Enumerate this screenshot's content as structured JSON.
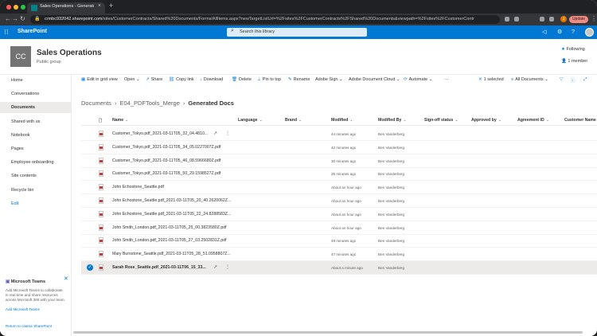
{
  "browser": {
    "tab_title": "Sales Operations - Generated",
    "url_domain": "crmbc932042.sharepoint.com",
    "url_path": "/sites/CustomerContracts/Shared%20Documents/Forms/AllItems.aspx?newTargetListUrl=%2Fsites%2FCustomerContracts%2FShared%20Documents&viewpath=%2Fsites%2FCustomerContr",
    "profile_initial": "J",
    "update_label": "Update"
  },
  "suite": {
    "brand": "SharePoint",
    "search_placeholder": "Search this library"
  },
  "site": {
    "logo_text": "CC",
    "title": "Sales Operations",
    "subtitle": "Public group",
    "following": "Following",
    "members": "1 member"
  },
  "nav": {
    "items": [
      "Home",
      "Conversations",
      "Documents",
      "Shared with us",
      "Notebook",
      "Pages",
      "Employee onboarding",
      "Site contents",
      "Recycle bin"
    ],
    "edit": "Edit",
    "return_classic": "Return to classic SharePoint"
  },
  "teams_card": {
    "title": "Microsoft Teams",
    "body": "Add Microsoft Teams to collaborate in real time and share resources across Microsoft 365 with your team.",
    "link": "Add Microsoft Teams"
  },
  "commands": {
    "edit_grid": "Edit in grid view",
    "open": "Open",
    "share": "Share",
    "copy_link": "Copy link",
    "download": "Download",
    "delete": "Delete",
    "pin": "Pin to top",
    "rename": "Rename",
    "adobe_sign": "Adobe Sign",
    "adobe_cloud": "Adobe Document Cloud",
    "automate": "Automate",
    "selected": "1 selected",
    "view": "All Documents"
  },
  "breadcrumb": [
    "Documents",
    "E04_PDFTools_Merge",
    "Generated Docs"
  ],
  "columns": [
    "Name",
    "Language",
    "Brand",
    "Modified",
    "Modified By",
    "Sign-off status",
    "Approved by",
    "Agreement ID",
    "Customer Name"
  ],
  "rows": [
    {
      "name": "Customer_Tokyo.pdf_2021-03-11T05_32_04.4810...",
      "modified": "44 minutes ago",
      "by": "Ben Vanderberg",
      "share": true
    },
    {
      "name": "Customer_Tokyo.pdf_2021-03-11T05_34_05.0227007Z.pdf",
      "modified": "42 minutes ago",
      "by": "Ben Vanderberg",
      "share": false
    },
    {
      "name": "Customer_Tokyo.pdf_2021-03-11T05_46_08.5966680Z.pdf",
      "modified": "30 minutes ago",
      "by": "Ben Vanderberg",
      "share": false
    },
    {
      "name": "Customer_Tokyo.pdf_2021-03-11T05_50_29.1598527Z.pdf",
      "modified": "26 minutes ago",
      "by": "Ben Vanderberg",
      "share": false
    },
    {
      "name": "John Echostone_Seattle.pdf",
      "modified": "About an hour ago",
      "by": "Ben Vanderberg",
      "share": false
    },
    {
      "name": "John Echostone_Seattle.pdf_2021-03-11T05_20_40.2620062Z...",
      "modified": "About an hour ago",
      "by": "Ben Vanderberg",
      "share": false
    },
    {
      "name": "John Echostone_Seattle.pdf_2021-03-11T05_22_24.8288583Z...",
      "modified": "About an hour ago",
      "by": "Ben Vanderberg",
      "share": false
    },
    {
      "name": "John Smith_London.pdf_2021-03-11T05_25_00.3823580Z.pdf",
      "modified": "About an hour ago",
      "by": "Ben Vanderberg",
      "share": false
    },
    {
      "name": "John Smith_London.pdf_2021-03-11T05_27_03.2502831Z.pdf",
      "modified": "49 minutes ago",
      "by": "Ben Vanderberg",
      "share": false
    },
    {
      "name": "Mary Burostone_Seattle.pdf_2021-03-11T05_28_51.0958807Z...",
      "modified": "47 minutes ago",
      "by": "Ben Vanderberg",
      "share": false
    },
    {
      "name": "Sarah Rose_Seattle.pdf_2021-03-11T06_15_33...",
      "modified": "About a minute ago",
      "by": "Ben Vanderberg",
      "share": true,
      "selected": true
    }
  ]
}
